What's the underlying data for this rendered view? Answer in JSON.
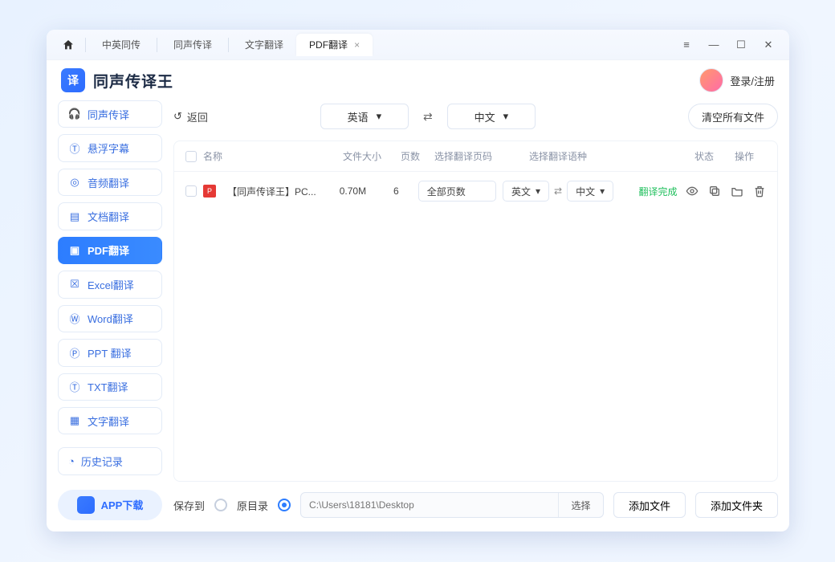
{
  "tabs": {
    "items": [
      "中英同传",
      "同声传译",
      "文字翻译",
      "PDF翻译"
    ],
    "close": "×"
  },
  "header": {
    "title": "同声传译王",
    "login": "登录/注册"
  },
  "sidebar": {
    "items": [
      {
        "label": "同声传译"
      },
      {
        "label": "悬浮字幕"
      },
      {
        "label": "音频翻译"
      },
      {
        "label": "文档翻译"
      },
      {
        "label": "PDF翻译"
      },
      {
        "label": "Excel翻译"
      },
      {
        "label": "Word翻译"
      },
      {
        "label": "PPT 翻译"
      },
      {
        "label": "TXT翻译"
      },
      {
        "label": "文字翻译"
      }
    ],
    "history": "历史记录",
    "app_download": "APP下载"
  },
  "toolbar": {
    "back": "返回",
    "source_lang": "英语",
    "target_lang": "中文",
    "clear": "清空所有文件"
  },
  "table": {
    "headers": {
      "name": "名称",
      "size": "文件大小",
      "pages": "页数",
      "page_sel": "选择翻译页码",
      "lang_sel": "选择翻译语种",
      "status": "状态",
      "ops": "操作"
    },
    "rows": [
      {
        "name": "【同声传译王】PC...",
        "size": "0.70M",
        "pages": "6",
        "page_sel_label": "全部页数",
        "src": "英文",
        "tgt": "中文",
        "status": "翻译完成"
      }
    ]
  },
  "footer": {
    "save_to": "保存到",
    "orig_dir": "原目录",
    "path_placeholder": "C:\\Users\\18181\\Desktop",
    "choose": "选择",
    "add_file": "添加文件",
    "add_folder": "添加文件夹"
  }
}
